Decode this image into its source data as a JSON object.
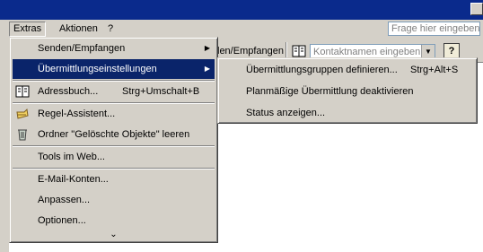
{
  "menubar": {
    "items": [
      "Extras",
      "Aktionen",
      "?"
    ]
  },
  "search": {
    "placeholder": "Frage hier eingeben"
  },
  "toolbar": {
    "send_receive_label": "len/Empfangen",
    "contact_search_placeholder": "Kontaktnamen eingeben",
    "help_label": "?"
  },
  "extras_menu": {
    "items": [
      {
        "label": "Senden/Empfangen",
        "submenu": true
      },
      {
        "label": "Übermittlungseinstellungen",
        "submenu": true,
        "selected": true
      },
      {
        "label": "Adressbuch...",
        "shortcut": "Strg+Umschalt+B",
        "icon": "address-book-icon"
      },
      {
        "label": "Regel-Assistent...",
        "icon": "rules-wizard-icon"
      },
      {
        "label": "Ordner \"Gelöschte Objekte\" leeren",
        "icon": "empty-trash-icon"
      },
      {
        "label": "Tools im Web..."
      },
      {
        "label": "E-Mail-Konten..."
      },
      {
        "label": "Anpassen..."
      },
      {
        "label": "Optionen..."
      }
    ],
    "expand_label": "⌄"
  },
  "sync_submenu": {
    "items": [
      {
        "label": "Übermittlungsgruppen definieren...",
        "shortcut": "Strg+Alt+S"
      },
      {
        "label": "Planmäßige Übermittlung deaktivieren"
      },
      {
        "label": "Status anzeigen..."
      }
    ]
  }
}
